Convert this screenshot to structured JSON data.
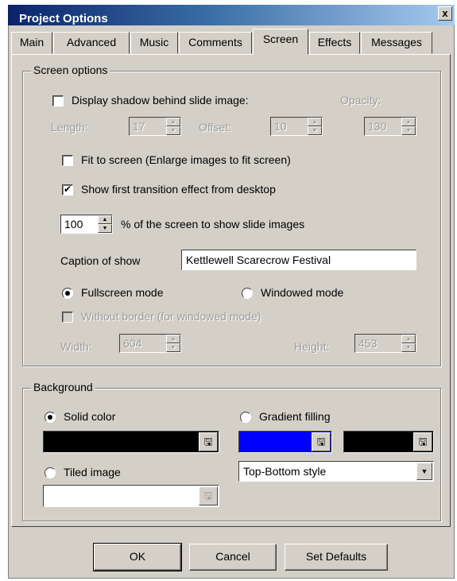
{
  "window": {
    "title": "Project Options",
    "close_glyph": "x"
  },
  "tabs": [
    {
      "label": "Main"
    },
    {
      "label": "Advanced"
    },
    {
      "label": "Music"
    },
    {
      "label": "Comments"
    },
    {
      "label": "Screen",
      "active": true
    },
    {
      "label": "Effects"
    },
    {
      "label": "Messages"
    }
  ],
  "screen_options": {
    "group_label": "Screen options",
    "display_shadow": {
      "label": "Display shadow behind slide image:",
      "checked": false
    },
    "opacity": {
      "label": "Opacity:",
      "value": "130"
    },
    "length": {
      "label": "Length:",
      "value": "17"
    },
    "offset": {
      "label": "Offset:",
      "value": "10"
    },
    "fit_to_screen": {
      "label": "Fit to screen (Enlarge images to fit screen)",
      "checked": false
    },
    "show_first_transition": {
      "label": "Show first transition effect from desktop",
      "checked": true
    },
    "percent": {
      "value": "100",
      "label": "% of the screen to show slide images"
    },
    "caption": {
      "label": "Caption of show",
      "value": "Kettlewell Scarecrow Festival"
    },
    "fullscreen_mode": {
      "label": "Fullscreen mode",
      "selected": true
    },
    "windowed_mode": {
      "label": "Windowed mode",
      "selected": false
    },
    "without_border": {
      "label": "Without border (for windowed mode)",
      "checked": false
    },
    "width": {
      "label": "Width:",
      "value": "604"
    },
    "height": {
      "label": "Height:",
      "value": "453"
    }
  },
  "background": {
    "group_label": "Background",
    "solid_color": {
      "label": "Solid color",
      "selected": true,
      "color": "#000000"
    },
    "gradient_filling": {
      "label": "Gradient filling",
      "selected": false,
      "color1": "#0000ff",
      "color2": "#000000"
    },
    "tiled_image": {
      "label": "Tiled image",
      "selected": false,
      "value": ""
    },
    "gradient_style": {
      "value": "Top-Bottom style"
    }
  },
  "buttons": {
    "ok": "OK",
    "cancel": "Cancel",
    "set_defaults": "Set Defaults"
  },
  "icons": {
    "picker": "folder-picker-icon",
    "spin": "spin-arrows-icon"
  }
}
